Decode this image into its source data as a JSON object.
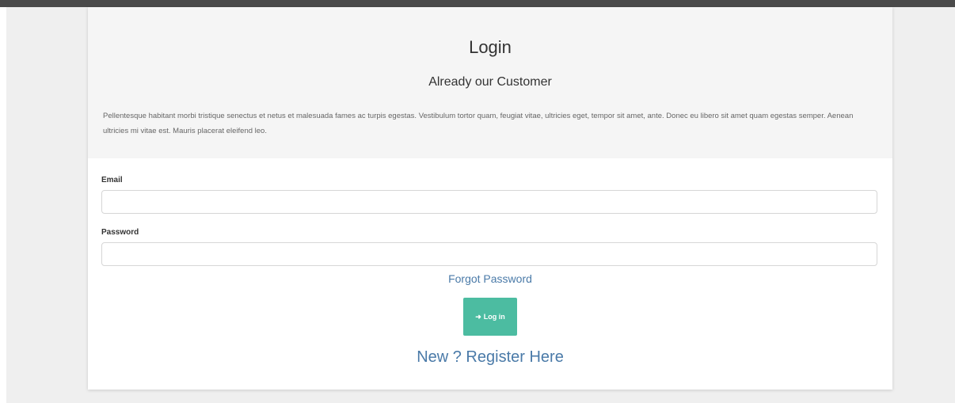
{
  "login": {
    "title": "Login",
    "subtitle": "Already our Customer",
    "description": "Pellentesque habitant morbi tristique senectus et netus et malesuada fames ac turpis egestas. Vestibulum tortor quam, feugiat vitae, ultricies eget, tempor sit amet, ante. Donec eu libero sit amet quam egestas semper. Aenean ultricies mi vitae est. Mauris placerat eleifend leo.",
    "email_label": "Email",
    "email_value": "",
    "password_label": "Password",
    "password_value": "",
    "forgot_link": "Forgot Password",
    "login_button": "Log in",
    "login_icon_glyph": "➜",
    "register_link": "New ? Register Here"
  },
  "colors": {
    "accent_button": "#4cbca1",
    "link": "#4a7aa8",
    "header_bg": "#f5f5f5"
  },
  "icons": {
    "login_icon": "sign-in-icon"
  }
}
